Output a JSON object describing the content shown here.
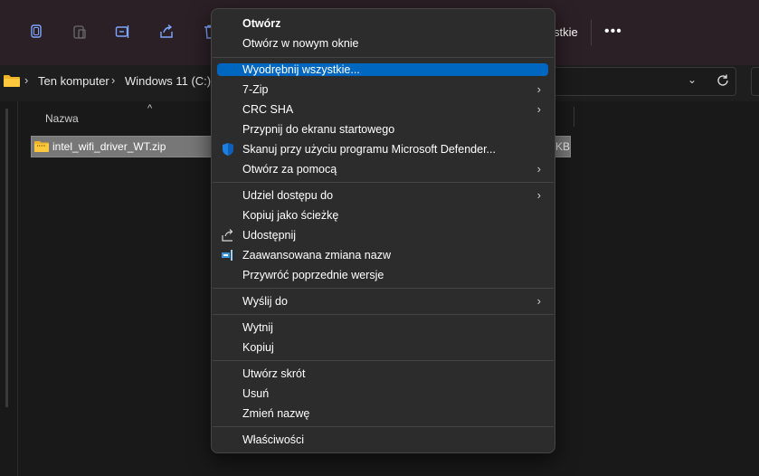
{
  "toolbar": {
    "partial_label": "stkie",
    "more_label": "•••",
    "icons": [
      "copy-icon",
      "paste-icon",
      "rename-icon",
      "share-icon",
      "delete-icon"
    ]
  },
  "breadcrumb": {
    "items": [
      "Ten komputer",
      "Windows 11 (C:)"
    ],
    "separator": "›"
  },
  "address": {
    "dropdown_glyph": "⌄"
  },
  "file_list": {
    "column_name": "Nazwa",
    "sort_glyph": "^",
    "file": {
      "name": "intel_wifi_driver_WT.zip",
      "size_partial": "KB"
    }
  },
  "context_menu": {
    "chevron": "›",
    "groups": [
      [
        {
          "label": "Otwórz",
          "bold": true
        },
        {
          "label": "Otwórz w nowym oknie"
        }
      ],
      [
        {
          "label": "Wyodrębnij wszystkie...",
          "highlighted": true
        },
        {
          "label": "7-Zip",
          "submenu": true
        },
        {
          "label": "CRC SHA",
          "submenu": true
        },
        {
          "label": "Przypnij do ekranu startowego"
        },
        {
          "label": "Skanuj przy użyciu programu Microsoft Defender...",
          "icon": "defender-shield-icon"
        },
        {
          "label": "Otwórz za pomocą",
          "submenu": true
        }
      ],
      [
        {
          "label": "Udziel dostępu do",
          "submenu": true
        },
        {
          "label": "Kopiuj jako ścieżkę"
        },
        {
          "label": "Udostępnij",
          "icon": "share-icon"
        },
        {
          "label": "Zaawansowana zmiana nazw",
          "icon": "power-rename-icon"
        },
        {
          "label": "Przywróć poprzednie wersje"
        }
      ],
      [
        {
          "label": "Wyślij do",
          "submenu": true
        }
      ],
      [
        {
          "label": "Wytnij"
        },
        {
          "label": "Kopiuj"
        }
      ],
      [
        {
          "label": "Utwórz skrót"
        },
        {
          "label": "Usuń"
        },
        {
          "label": "Zmień nazwę"
        }
      ],
      [
        {
          "label": "Właściwości"
        }
      ]
    ]
  },
  "colors": {
    "toolbar_bg": "#2b2025",
    "window_bg": "#191919",
    "menu_bg": "#2c2c2c",
    "highlight": "#0067c0",
    "selection": "#777777"
  }
}
